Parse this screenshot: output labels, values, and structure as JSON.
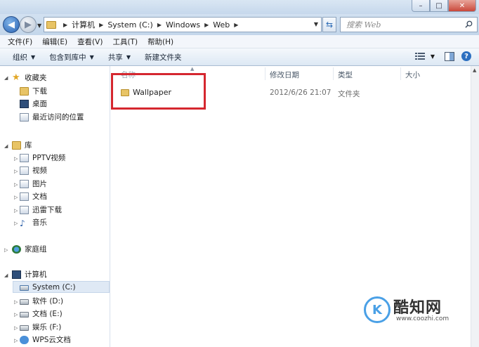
{
  "window": {
    "min_label": "–",
    "max_label": "□",
    "close_label": "✕"
  },
  "address": {
    "crumbs": [
      "计算机",
      "System (C:)",
      "Windows",
      "Web"
    ],
    "search_placeholder": "搜索 Web"
  },
  "menu": [
    "文件(F)",
    "编辑(E)",
    "查看(V)",
    "工具(T)",
    "帮助(H)"
  ],
  "commands": {
    "organize": "组织",
    "include_in_library": "包含到库中",
    "share": "共享",
    "new_folder": "新建文件夹"
  },
  "nav": {
    "favorites": "收藏夹",
    "downloads": "下载",
    "desktop": "桌面",
    "recent": "最近访问的位置",
    "libraries": "库",
    "pptv": "PPTV视频",
    "videos": "视频",
    "pictures": "图片",
    "documents": "文档",
    "xunlei": "迅雷下载",
    "music": "音乐",
    "homegroup": "家庭组",
    "computer": "计算机",
    "drive_c": "System (C:)",
    "drive_d": "软件 (D:)",
    "drive_e": "文档 (E:)",
    "drive_f": "娱乐 (F:)",
    "wps": "WPS云文档"
  },
  "columns": {
    "name": "名称",
    "modified": "修改日期",
    "type": "类型",
    "size": "大小"
  },
  "files": [
    {
      "name": "Wallpaper",
      "modified": "2012/6/26 21:07",
      "type": "文件夹",
      "size": ""
    }
  ],
  "watermark": {
    "logo_letter": "K",
    "title": "酷知网",
    "url": "www.coozhi.com"
  },
  "colors": {
    "highlight_box": "#d5272f",
    "folder": "#e8c466",
    "accent": "#2c6fc0"
  }
}
